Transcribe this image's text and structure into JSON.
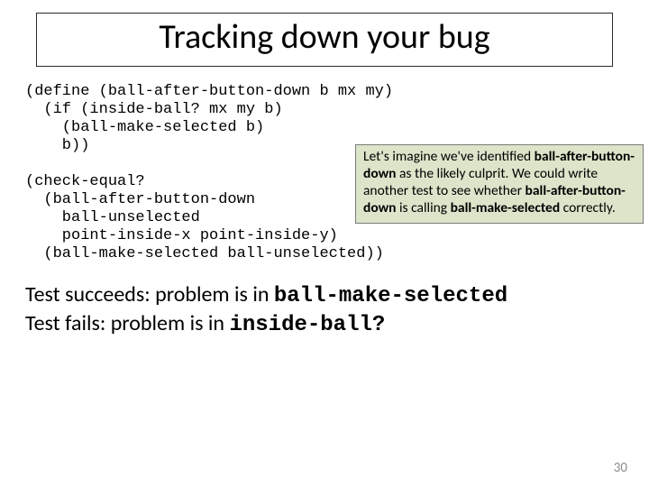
{
  "title": "Tracking down your bug",
  "code": {
    "l1": "(define (ball-after-button-down b mx my)",
    "l2": "  (if (inside-ball? mx my b)",
    "l3": "    (ball-make-selected b)",
    "l4": "    b))",
    "l5": "",
    "l6": "(check-equal?",
    "l7": "  (ball-after-button-down",
    "l8": "    ball-unselected",
    "l9": "    point-inside-x point-inside-y)",
    "l10": "  (ball-make-selected ball-unselected))"
  },
  "callout": {
    "t1": "Let's imagine we've identified ",
    "b1": "ball-after-button-down",
    "t2": " as the likely culprit.  We could write another test to see whether ",
    "b2": "ball-after-button-down",
    "t3": " is calling ",
    "b3": "ball-make-selected",
    "t4": " correctly."
  },
  "conclusion": {
    "succ_pre": "Test succeeds: problem is in ",
    "succ_code": "ball-make-selected",
    "fail_pre": "Test fails: problem is in ",
    "fail_code": "inside-ball?"
  },
  "page_number": "30"
}
